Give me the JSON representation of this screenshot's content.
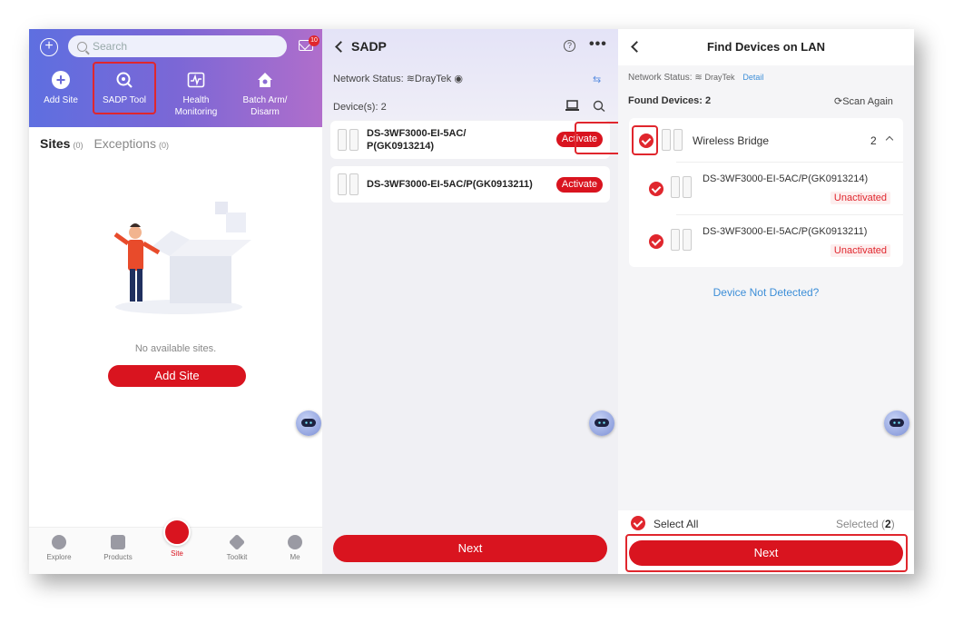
{
  "panel1": {
    "search_placeholder": "Search",
    "mail_badge": "10",
    "tools": [
      {
        "label": "Add Site",
        "icon": "add-circle-icon"
      },
      {
        "label": "SADP Tool",
        "icon": "sadp-search-icon"
      },
      {
        "label": "Health\nMonitoring",
        "icon": "health-monitor-icon"
      },
      {
        "label": "Batch Arm/\nDisarm",
        "icon": "home-arm-icon"
      }
    ],
    "tabs": {
      "sites": "Sites",
      "sites_count": "(0)",
      "exceptions": "Exceptions",
      "exceptions_count": "(0)"
    },
    "empty_text": "No available sites.",
    "add_site_button": "Add Site",
    "nav": [
      {
        "label": "Explore",
        "icon": "compass-icon"
      },
      {
        "label": "Products",
        "icon": "grid-icon"
      },
      {
        "label": "Site",
        "icon": "globe-icon"
      },
      {
        "label": "Toolkit",
        "icon": "layers-icon"
      },
      {
        "label": "Me",
        "icon": "user-icon"
      }
    ]
  },
  "panel2": {
    "title": "SADP",
    "network_label": "Network Status:",
    "network_name": "DrayTek",
    "devices_label": "Device(s):",
    "devices_count": "2",
    "devices": [
      {
        "name_line1": "DS-3WF3000-EI-5AC/",
        "name_line2": "P(GK0913214)",
        "action": "Activate"
      },
      {
        "name_line1": "DS-3WF3000-EI-5AC/P(GK0913211)",
        "name_line2": "",
        "action": "Activate"
      }
    ],
    "next_button": "Next"
  },
  "panel3": {
    "title": "Find Devices on LAN",
    "network_label": "Network Status:",
    "network_name": "DrayTek",
    "detail_link": "Detail",
    "found_label": "Found Devices:",
    "found_count": "2",
    "scan_again": "Scan Again",
    "group_name": "Wireless Bridge",
    "group_count": "2",
    "devices": [
      {
        "name": "DS-3WF3000-EI-5AC/P(GK0913214)",
        "status": "Unactivated"
      },
      {
        "name": "DS-3WF3000-EI-5AC/P(GK0913211)",
        "status": "Unactivated"
      }
    ],
    "not_detected": "Device Not Detected?",
    "select_all": "Select All",
    "selected_label": "Selected",
    "selected_count": "2",
    "next_button": "Next"
  },
  "colors": {
    "accent_red": "#d9141f",
    "link_blue": "#3e8fd8",
    "header_gradient_start": "#5e6fe0",
    "header_gradient_end": "#b06ecb"
  }
}
